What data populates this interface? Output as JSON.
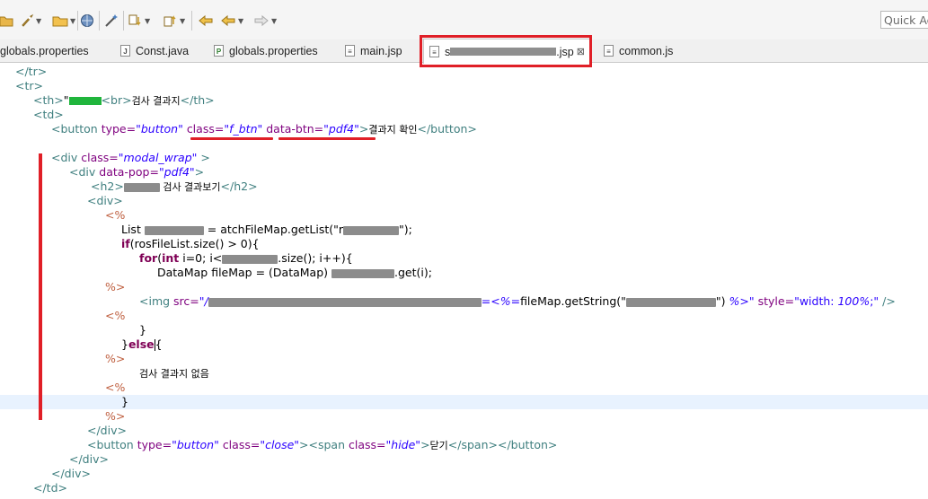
{
  "toolbar": {
    "quick_access_placeholder": "Quick Access",
    "icons": [
      "open-folder-icon",
      "rocket-icon",
      "folder-icon",
      "globe-icon",
      "wand-icon",
      "navigate-down-icon",
      "navigate-up-icon",
      "last-edit-icon",
      "back-arrow-icon",
      "forward-arrow-icon"
    ]
  },
  "tabs": [
    {
      "label": "globals.properties",
      "icon": "properties-file-icon",
      "icon_glyph": "≡"
    },
    {
      "label": "Const.java",
      "icon": "java-file-icon",
      "icon_glyph": "J"
    },
    {
      "label": "globals.properties",
      "icon": "properties-file-icon",
      "icon_glyph": "P"
    },
    {
      "label": "main.jsp",
      "icon": "jsp-file-icon",
      "icon_glyph": "≡"
    },
    {
      "label_prefix": "s",
      "label_suffix": ".jsp",
      "icon": "jsp-file-icon",
      "icon_glyph": "≡",
      "active": true
    },
    {
      "label": "common.js",
      "icon": "js-file-icon",
      "icon_glyph": "≡"
    }
  ],
  "tab_close_glyph": "⊠",
  "code": {
    "l01_close_tr": "</tr>",
    "l02_open_tr": "<tr>",
    "l03_th_open": "<th>",
    "l03_th_text": "\"",
    "l03_br": "<br>",
    "l03_text": "검사 결과지",
    "l03_th_close": "</th>",
    "l04_td": "<td>",
    "l05_btn_open": "<button",
    "l05_type_attr": "type=",
    "l05_type_val": "\"button\"",
    "l05_class_attr": "class=",
    "l05_class_val": "\"f_btn\"",
    "l05_data_btn_attr": "data-btn=",
    "l05_data_btn_val": "\"pdf4\"",
    "l05_gt": ">",
    "l05_text": "결과지 확인",
    "l05_btn_close": "</button>",
    "l06_div_open": "<div",
    "l06_class_attr": "class=",
    "l06_class_val": "\"modal_wrap\"",
    "l06_gt": " >",
    "l07_div_open": "<div",
    "l07_data_pop_attr": "data-pop=",
    "l07_data_pop_val": "\"pdf4\"",
    "l07_gt": ">",
    "l08_h2": "<h2>",
    "l08_text": " 검사 결과보기",
    "l08_h2_close": "</h2>",
    "l09_div": "<div>",
    "l10_jsp_open": "<%",
    "l11_list": "List ",
    "l11_assign": " = atchFileMap.getList(\"r",
    "l11_end": "\");",
    "l12_if": "if",
    "l12_rest": "(rosFileList.size() > 0){",
    "l13_for": "for",
    "l13_paren": "(",
    "l13_int": "int",
    "l13_rest1": " i=0; i<",
    "l13_rest2": ".size(); i++){",
    "l14_datamap": "DataMap fileMap = (DataMap) ",
    "l14_get": ".get(i);",
    "l15_jsp_close": "%>",
    "l16_img": "<img",
    "l16_src_attr": "src=",
    "l16_src_val_start": "\"/",
    "l16_src_val_mid": "=<%=",
    "l16_getstring": "fileMap.getString(\"",
    "l16_getstring_end": "\")",
    "l16_jsp_end": " %>\"",
    "l16_style_attr": "style=",
    "l16_style_val_a": "\"width: ",
    "l16_style_val_b": "100%",
    "l16_style_val_c": ";\"",
    "l16_selfclose": " />",
    "l17_jsp_open": "<%",
    "l18_brace": "}",
    "l19_else": "}",
    "l19_else_kw": "else",
    "l19_brace": "{",
    "l20_jsp_close": "%>",
    "l21_text": "검사 결과지 없음",
    "l22_jsp_open": "<%",
    "l23_brace": "}",
    "l24_jsp_close": "%>",
    "l25_div_close": "</div>",
    "l26_btn_open": "<button",
    "l26_type_attr": "type=",
    "l26_type_val": "\"button\"",
    "l26_class_attr": "class=",
    "l26_class_val": "\"close\"",
    "l26_gt": ">",
    "l26_span_open": "<span",
    "l26_span_class_attr": "class=",
    "l26_span_class_val": "\"hide\"",
    "l26_span_gt": ">",
    "l26_text": "닫기",
    "l26_span_close": "</span>",
    "l26_btn_close": "</button>",
    "l27_div_close": "</div>",
    "l28_div_close": "</div>",
    "l29_td_close": "</td>"
  }
}
